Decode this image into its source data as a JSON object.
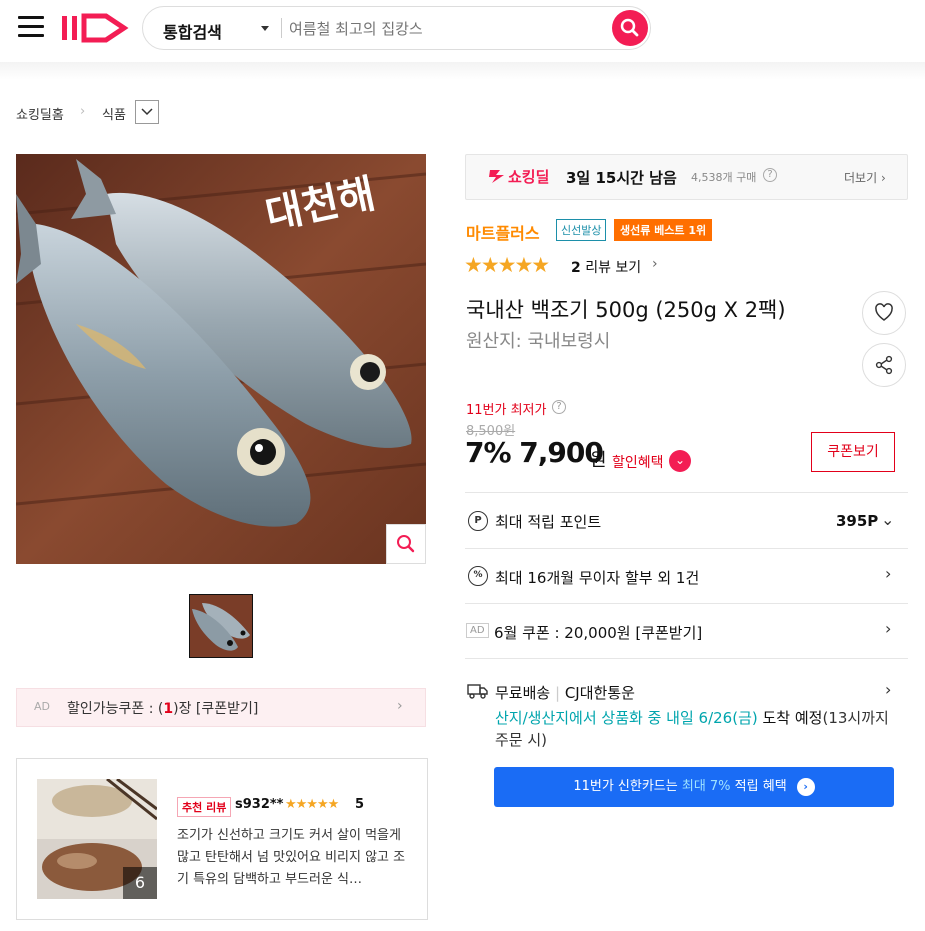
{
  "header": {
    "search_category": "통합검색",
    "search_placeholder": "여름철 최고의 집캉스"
  },
  "breadcrumb": {
    "home": "쇼킹딜홈",
    "category": "식품"
  },
  "gallery": {
    "image_brand_text": "대천해"
  },
  "coupon_banner": {
    "ad_label": "AD",
    "prefix": "할인가능쿠폰 : (",
    "count": "1",
    "suffix": ")장 [쿠폰받기]"
  },
  "review_card": {
    "photo_count": "6",
    "badge": "추천 리뷰",
    "user": "s932**",
    "stars": "★★★★★",
    "score": "5",
    "body": "조기가 신선하고 크기도 커서 살이 먹을게 많고 탄탄해서 넘 맛있어요 비리지 않고 조기 특유의 담백하고 부드러운 식…"
  },
  "deal": {
    "logo": "쇼킹딜",
    "time_left": "3일 15시간 남음",
    "purchase_count": "4,538개 구매",
    "more": "더보기"
  },
  "product": {
    "brand": "마트플러스",
    "tag_fresh": "신선발상",
    "tag_best": "생선류 베스트 1위",
    "rating_stars": "★★★★★",
    "review_count": "2",
    "review_link": "리뷰 보기",
    "title": "국내산 백조기 500g (250g X 2팩)",
    "origin": "원산지:  국내보령시"
  },
  "price": {
    "lowest_label": "11번가 최저가",
    "original": "8,500원",
    "discount_and_price": "7% 7,900",
    "currency": "원",
    "benefit_label": "할인혜택",
    "coupon_button": "쿠폰보기"
  },
  "benefits": {
    "point_label": "최대 적립 포인트",
    "point_value": "395P",
    "installment": "최대 16개월 무이자 할부 외 1건",
    "ad_label": "AD",
    "coupon_offer": "6월 쿠폰 : 20,000원 [쿠폰받기]"
  },
  "shipping": {
    "free": "무료배송",
    "carrier": "CJ대한통운",
    "eta_main": "산지/생산지에서 상품화 중 내일 6/26(금)",
    "eta_suffix": " 도착 예정",
    "eta_note": "(13시까지 주문 시)"
  },
  "card_promo": {
    "prefix": "11번가 신한카드는 ",
    "highlight": "최대 7%",
    "suffix": " 적립 혜택"
  },
  "colors": {
    "brand_red": "#f31d54",
    "accent_orange": "#ff8a00",
    "eta_teal": "#00a5ad",
    "promo_blue": "#1a6cf5"
  }
}
